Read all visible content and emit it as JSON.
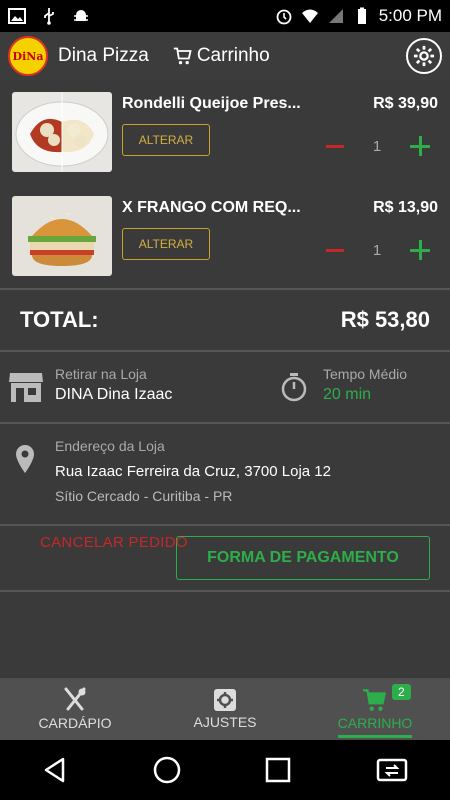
{
  "status_bar": {
    "time": "5:00 PM"
  },
  "app_bar": {
    "logo_text": "DiNa",
    "app_name": "Dina Pizza",
    "cart_label": "Carrinho"
  },
  "cart_items": [
    {
      "name": "Rondelli Queijoe Pres...",
      "price": "R$ 39,90",
      "alter_label": "ALTERAR",
      "qty": "1"
    },
    {
      "name": "X FRANGO COM REQ...",
      "price": "R$ 13,90",
      "alter_label": "ALTERAR",
      "qty": "1"
    }
  ],
  "total": {
    "label": "TOTAL:",
    "value": "R$ 53,80"
  },
  "pickup": {
    "mode_label": "Retirar na Loja",
    "store_name": "DINA Dina Izaac",
    "time_label": "Tempo Médio",
    "time_value": "20 min"
  },
  "address": {
    "label": "Endereço da Loja",
    "line1": "Rua Izaac Ferreira da Cruz, 3700 Loja 12",
    "line2": "Sítio Cercado - Curitiba - PR"
  },
  "payment_button": "FORMA DE PAGAMENTO",
  "cancel_label": "CANCELAR PEDIDO",
  "bottom_nav": [
    {
      "label": "CARDÁPIO",
      "icon": "fork-knife-icon"
    },
    {
      "label": "AJUSTES",
      "icon": "settings-icon"
    },
    {
      "label": "CARRINHO",
      "icon": "cart-icon",
      "badge": "2"
    }
  ],
  "colors": {
    "accent_green": "#2eae4a",
    "accent_red": "#c62828",
    "accent_gold": "#c9a227"
  }
}
